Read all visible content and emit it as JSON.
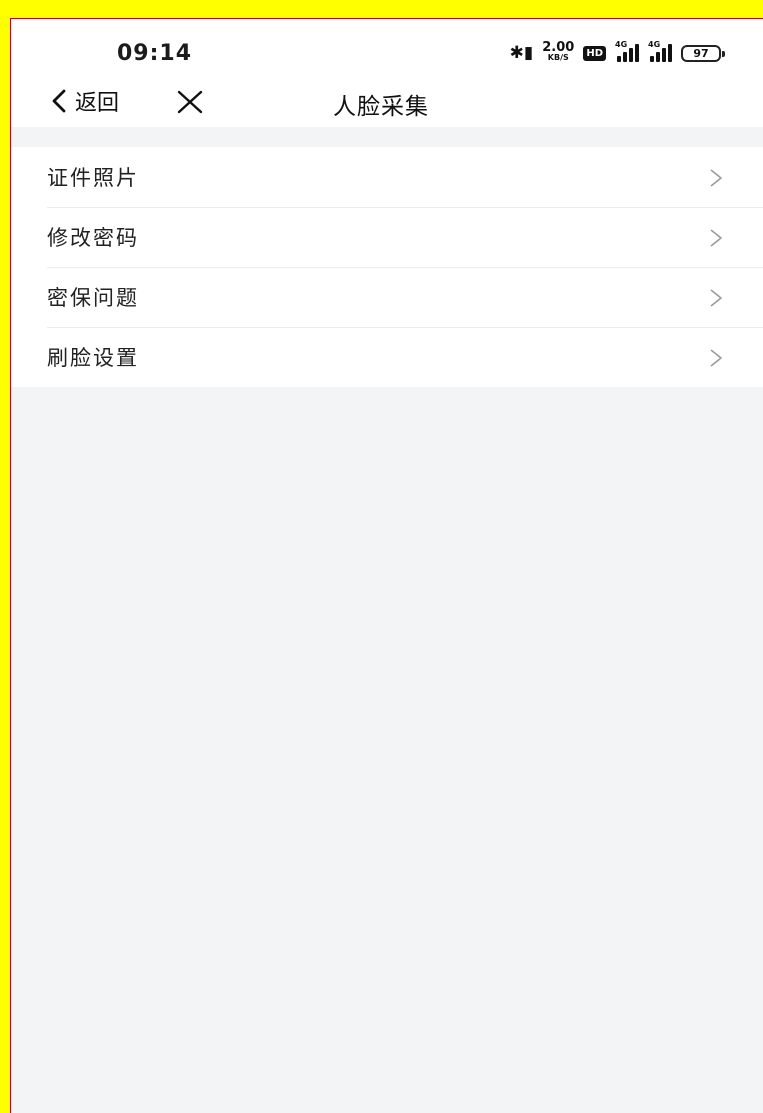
{
  "status_bar": {
    "time": "09:14",
    "bluetooth_icon": "bluetooth-icon",
    "speed_value": "2.00",
    "speed_unit": "KB/S",
    "hd_badge": "HD",
    "signal_1_tag": "4G",
    "signal_2_tag": "4G",
    "battery_level": "97"
  },
  "nav": {
    "back_label": "返回",
    "back_icon": "chevron-left-icon",
    "close_icon": "close-icon",
    "title": "人脸采集"
  },
  "menu": {
    "items": [
      {
        "label": "证件照片"
      },
      {
        "label": "修改密码"
      },
      {
        "label": "密保问题"
      },
      {
        "label": "刷脸设置"
      }
    ],
    "chevron_icon": "chevron-right-icon"
  },
  "colors": {
    "outer_frame": "#ffff00",
    "frame_border": "#c40000",
    "page_background": "#f3f4f6",
    "surface": "#ffffff",
    "text_primary": "#222222",
    "chevron": "#9a9a9a"
  }
}
